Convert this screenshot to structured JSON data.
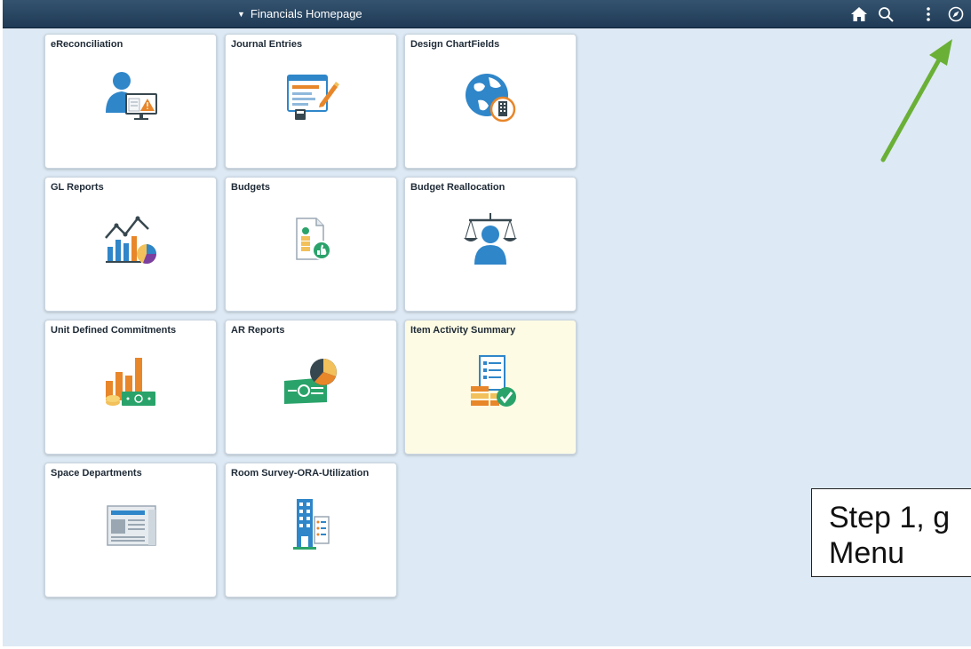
{
  "header": {
    "title": "Financials Homepage",
    "icons": [
      "home-icon",
      "search-icon",
      "actions-menu-icon",
      "navbar-compass-icon"
    ]
  },
  "tiles": [
    {
      "title": "eReconciliation",
      "icon": "user-monitor-warning-icon"
    },
    {
      "title": "Journal Entries",
      "icon": "form-pencil-icon"
    },
    {
      "title": "Design ChartFields",
      "icon": "globe-building-icon"
    },
    {
      "title": "GL Reports",
      "icon": "line-bar-pie-chart-icon"
    },
    {
      "title": "Budgets",
      "icon": "document-thumbs-up-icon"
    },
    {
      "title": "Budget Reallocation",
      "icon": "scales-person-icon"
    },
    {
      "title": "Unit Defined Commitments",
      "icon": "bar-chart-money-icon"
    },
    {
      "title": "AR Reports",
      "icon": "cash-pie-chart-icon"
    },
    {
      "title": "Item Activity Summary",
      "icon": "list-coins-check-icon"
    },
    {
      "title": "Space Departments",
      "icon": "newspaper-icon"
    },
    {
      "title": "Room Survey-ORA-Utilization",
      "icon": "building-list-icon"
    }
  ],
  "callout": {
    "line1": "Step 1, g",
    "line2": "Menu"
  },
  "colors": {
    "header_bg": "#2a4765",
    "page_bg": "#dde9f4",
    "tile_bg": "#ffffff",
    "tile_highlight_bg": "#fdfbe4",
    "arrow": "#6ab036",
    "icon_blue": "#2f86c9",
    "icon_orange": "#e8862a",
    "icon_green": "#2aa36a"
  }
}
